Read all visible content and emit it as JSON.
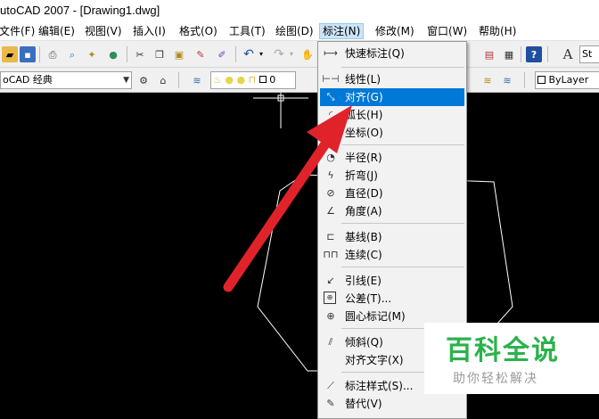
{
  "window": {
    "title": "utoCAD 2007 - [Drawing1.dwg]"
  },
  "menubar": {
    "items": [
      "文件(F)",
      "编辑(E)",
      "视图(V)",
      "插入(I)",
      "格式(O)",
      "工具(T)",
      "绘图(D)",
      "标注(N)",
      "修改(M)",
      "窗口(W)",
      "帮助(H)"
    ],
    "active": "标注(N)"
  },
  "toolbar": {
    "workspace": "oCAD 经典",
    "layer": "0",
    "style_partial": "St",
    "linetype": "ByLayer"
  },
  "dimension_menu": {
    "items": [
      {
        "label": "快速标注(Q)",
        "icon": "quick-dimension-icon"
      },
      {
        "label": "线性(L)",
        "icon": "linear-dimension-icon"
      },
      {
        "label": "对齐(G)",
        "icon": "aligned-dimension-icon",
        "highlighted": true
      },
      {
        "label": "弧长(H)",
        "icon": "arc-length-icon"
      },
      {
        "label": "坐标(O)",
        "icon": "ordinate-icon"
      },
      {
        "label": "半径(R)",
        "icon": "radius-icon"
      },
      {
        "label": "折弯(J)",
        "icon": "jogged-icon"
      },
      {
        "label": "直径(D)",
        "icon": "diameter-icon"
      },
      {
        "label": "角度(A)",
        "icon": "angular-icon"
      },
      {
        "label": "基线(B)",
        "icon": "baseline-icon"
      },
      {
        "label": "连续(C)",
        "icon": "continue-icon"
      },
      {
        "label": "引线(E)",
        "icon": "leader-icon"
      },
      {
        "label": "公差(T)...",
        "icon": "tolerance-icon"
      },
      {
        "label": "圆心标记(M)",
        "icon": "center-mark-icon"
      },
      {
        "label": "倾斜(Q)",
        "icon": "oblique-icon"
      },
      {
        "label": "对齐文字(X)",
        "icon": ""
      },
      {
        "label": "标注样式(S)...",
        "icon": "dimension-style-icon"
      },
      {
        "label": "替代(V)",
        "icon": "override-icon"
      }
    ]
  },
  "watermark": {
    "title": "百科全说",
    "subtitle": "助你轻松解决"
  },
  "colors": {
    "highlight": "#0078d7",
    "arrow": "#e0232a",
    "watermark_green": "#2bb24c"
  }
}
